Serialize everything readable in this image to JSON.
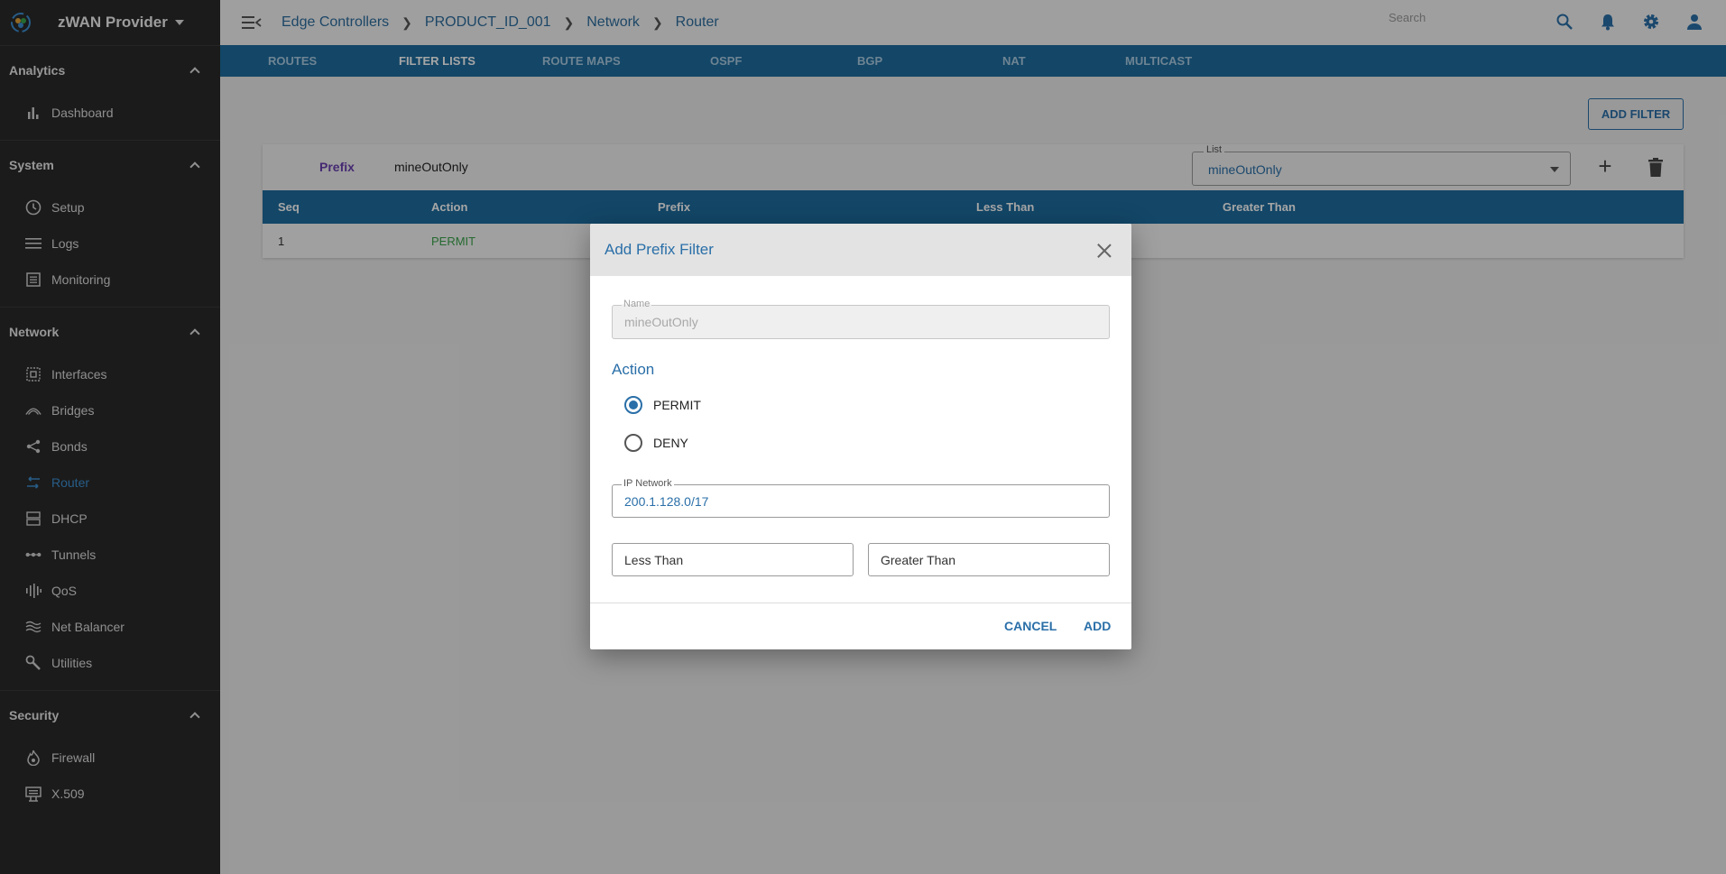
{
  "sidebar": {
    "brand": "zWAN Provider",
    "sections": [
      {
        "title": "Analytics",
        "items": [
          {
            "label": "Dashboard",
            "icon": "bar-chart-icon"
          }
        ]
      },
      {
        "title": "System",
        "items": [
          {
            "label": "Setup",
            "icon": "clock-icon"
          },
          {
            "label": "Logs",
            "icon": "lines-icon"
          },
          {
            "label": "Monitoring",
            "icon": "list-box-icon"
          }
        ]
      },
      {
        "title": "Network",
        "items": [
          {
            "label": "Interfaces",
            "icon": "interfaces-icon"
          },
          {
            "label": "Bridges",
            "icon": "bridge-icon"
          },
          {
            "label": "Bonds",
            "icon": "share-icon"
          },
          {
            "label": "Router",
            "icon": "swap-arrows-icon",
            "active": true
          },
          {
            "label": "DHCP",
            "icon": "server-icon"
          },
          {
            "label": "Tunnels",
            "icon": "tunnel-icon"
          },
          {
            "label": "QoS",
            "icon": "equalizer-icon"
          },
          {
            "label": "Net Balancer",
            "icon": "waves-icon"
          },
          {
            "label": "Utilities",
            "icon": "wrench-icon"
          }
        ]
      },
      {
        "title": "Security",
        "items": [
          {
            "label": "Firewall",
            "icon": "flame-icon"
          },
          {
            "label": "X.509",
            "icon": "certificate-icon"
          }
        ]
      }
    ]
  },
  "topbar": {
    "breadcrumbs": [
      "Edge Controllers",
      "PRODUCT_ID_001",
      "Network",
      "Router"
    ],
    "search_placeholder": "Search"
  },
  "tabs": [
    "ROUTES",
    "FILTER LISTS",
    "ROUTE MAPS",
    "OSPF",
    "BGP",
    "NAT",
    "MULTICAST"
  ],
  "active_tab": "FILTER LISTS",
  "content": {
    "add_filter_label": "ADD FILTER",
    "panel": {
      "type_label": "Prefix",
      "name": "mineOutOnly",
      "list_label": "List",
      "list_value": "mineOutOnly"
    },
    "table": {
      "columns": [
        "Seq",
        "Action",
        "Prefix",
        "Less Than",
        "Greater Than"
      ],
      "rows": [
        {
          "seq": "1",
          "action": "PERMIT"
        }
      ]
    }
  },
  "modal": {
    "title": "Add Prefix Filter",
    "name_label": "Name",
    "name_value": "mineOutOnly",
    "action_heading": "Action",
    "options": [
      "PERMIT",
      "DENY"
    ],
    "selected_option": "PERMIT",
    "ip_label": "IP Network",
    "ip_value": "200.1.128.0/17",
    "less_than_placeholder": "Less Than",
    "greater_than_placeholder": "Greater Than",
    "cancel_label": "CANCEL",
    "add_label": "ADD"
  },
  "colors": {
    "accent": "#2a6fa8",
    "tab_bar": "#1e6c9e",
    "sidebar_bg": "#2a2a2a",
    "permit_green": "#3aa34a"
  }
}
